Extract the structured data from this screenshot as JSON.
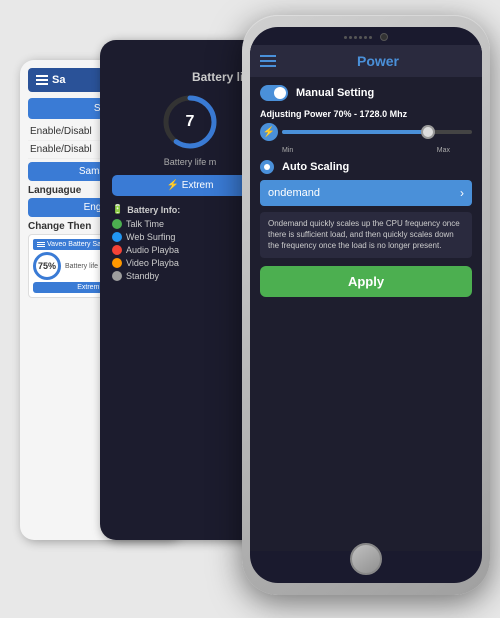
{
  "background": {
    "color": "#e0e0e0"
  },
  "left_panel": {
    "header_label": "Sa",
    "btn1": "Sh",
    "enable1": "Enable/Disabl",
    "enable2": "Enable/Disabl",
    "samsung": "Samsung",
    "language_label": "Languague",
    "english_btn": "English",
    "change_theme": "Change Then",
    "theme_name": "Vaveo Battery Sa",
    "theme_percent": "75%",
    "theme_battery_text": "Battery life m",
    "extreme_btn": "Extrem Saving"
  },
  "mid_panel": {
    "battery_percent": "7",
    "battery_life_text": "Battery life m",
    "extreme_btn": "Extrem",
    "battery_info_title": "Battery Info:",
    "items": [
      {
        "label": "Talk Time",
        "color": "#4CAF50"
      },
      {
        "label": "Web Surfing",
        "color": "#2196F3"
      },
      {
        "label": "Audio Playba",
        "color": "#F44336"
      },
      {
        "label": "Video Playba",
        "color": "#FF9800"
      },
      {
        "label": "Standby",
        "color": "#9E9E9E"
      }
    ]
  },
  "phone": {
    "title": "Power",
    "manual_setting_label": "Manual Setting",
    "adjusting_power_label": "Adjusting Power",
    "adjusting_power_value": "70% - 1728.0 Mhz",
    "slider_min": "Min",
    "slider_max": "Max",
    "slider_percent": 75,
    "auto_scaling_label": "Auto Scaling",
    "dropdown_value": "ondemand",
    "dropdown_arrow": "›",
    "description": "Ondemand quickly scales up the CPU frequency once there is sufficient load, and then quickly scales down the frequency once the load is no longer present.",
    "apply_label": "Apply"
  }
}
